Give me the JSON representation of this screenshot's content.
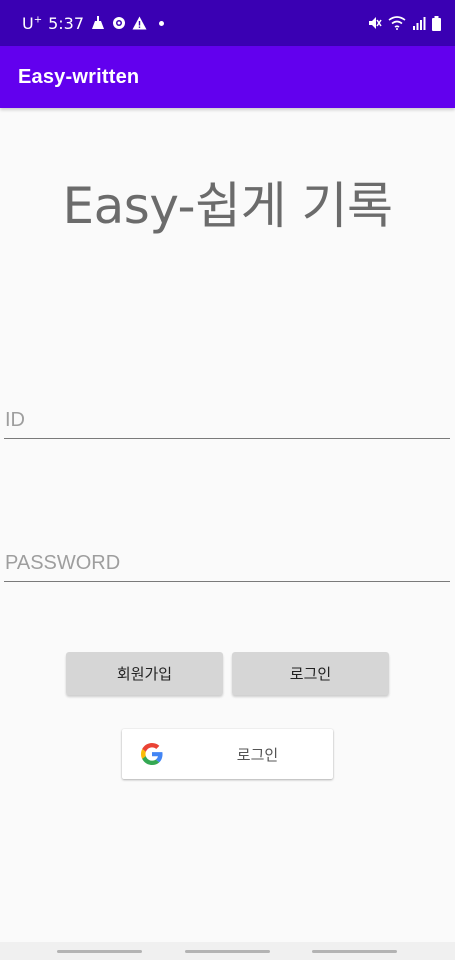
{
  "status_bar": {
    "carrier": "U",
    "carrier_sup": "+",
    "time": "5:37",
    "left_icons": [
      "cleaning-icon",
      "recording-icon",
      "warning-icon",
      "notification-dot-icon"
    ],
    "right_icons": [
      "mute-icon",
      "wifi-icon",
      "signal-icon",
      "battery-icon"
    ]
  },
  "app_bar": {
    "title": "Easy-written",
    "color": "#6200ee"
  },
  "main": {
    "heading": "Easy-쉽게 기록",
    "id_field": {
      "value": "",
      "placeholder": "ID"
    },
    "password_field": {
      "value": "",
      "placeholder": "PASSWORD"
    },
    "signup_label": "회원가입",
    "login_label": "로그인",
    "google_login_label": "로그인"
  },
  "colors": {
    "status_bar": "#3a00b3",
    "accent": "#6200ee",
    "button_bg": "#d6d6d6",
    "background": "#fafafa"
  }
}
